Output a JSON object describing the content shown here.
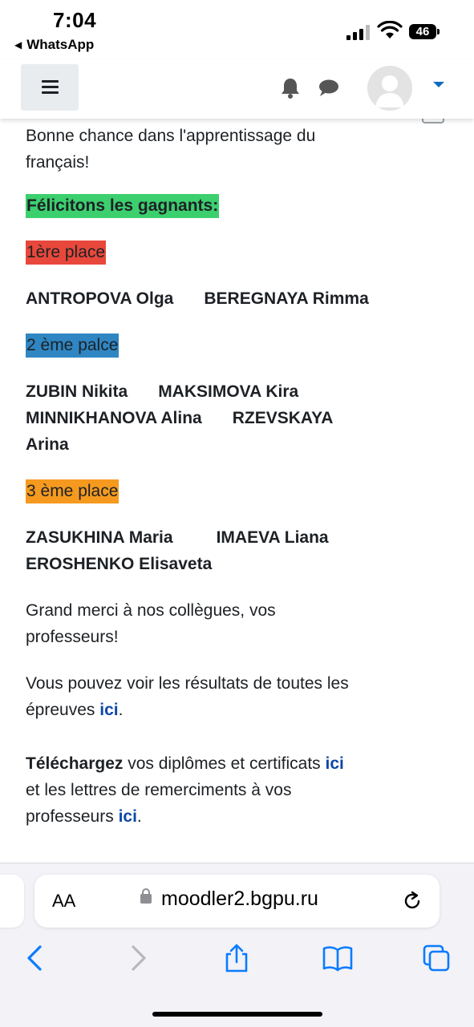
{
  "status_bar": {
    "time": "7:04",
    "back_app": "WhatsApp",
    "battery": "46"
  },
  "navbar": {
    "menu_icon": "hamburger-icon",
    "notification_icon": "bell-icon",
    "messages_icon": "chat-icon"
  },
  "content": {
    "intro_line1": "Bonne chance dans l'apprentissage du",
    "intro_line2": "français!",
    "congrats": "Félicitons les gagnants:",
    "place1": {
      "label": "1ère place",
      "color": "#e8483b",
      "names": [
        "ANTROPOVA Olga",
        "BEREGNAYA Rimma"
      ]
    },
    "place2": {
      "label": "2 ème palce",
      "color": "#2f86c2",
      "names": [
        "ZUBIN Nikita",
        "MAKSIMOVA Kira",
        "MINNIKHANOVA Alina",
        "RZEVSKAYA",
        "Arina"
      ]
    },
    "place3": {
      "label": "3 ème place",
      "color": "#f59a1f",
      "names": [
        "ZASUKHINA Maria",
        "IMAEVA Liana",
        "EROSHENKO Elisaveta"
      ]
    },
    "thanks_line1": "Grand merci à nos collègues, vos",
    "thanks_line2": "professeurs!",
    "results_line1": "Vous pouvez voir les résultats de toutes les",
    "results_line2": "épreuves ",
    "results_link": "ici",
    "results_end": ".",
    "download_bold": "Téléchargez",
    "download_text": " vos diplômes et certificats ",
    "download_link1": "ici",
    "letters_line": "et les lettres de remerciments à vos",
    "letters_line2": "professeurs ",
    "download_link2": "ici",
    "letters_end": ".",
    "congrats_color": "#3ccf6e",
    "link_color": "#0f47a8"
  },
  "safari": {
    "text_size_label": "AA",
    "url": "moodler2.bgpu.ru"
  }
}
